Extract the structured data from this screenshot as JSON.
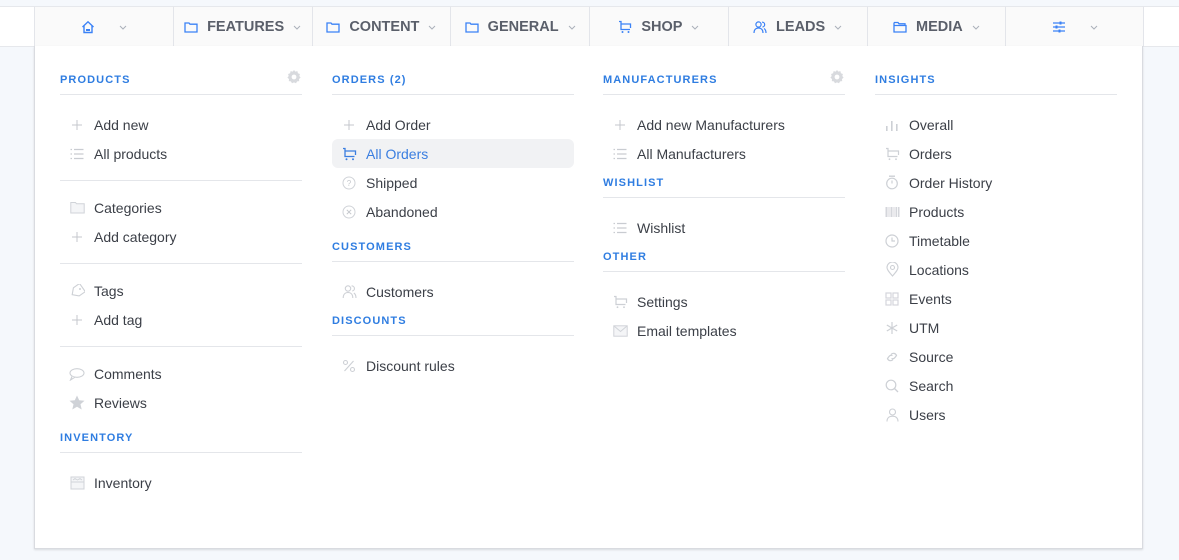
{
  "nav": {
    "items": [
      {
        "label": "",
        "icon": "home-icon"
      },
      {
        "label": "FEATURES",
        "icon": "folder-icon"
      },
      {
        "label": "CONTENT",
        "icon": "folder-icon"
      },
      {
        "label": "GENERAL",
        "icon": "folder-icon"
      },
      {
        "label": "SHOP",
        "icon": "cart-icon"
      },
      {
        "label": "LEADS",
        "icon": "users-icon"
      },
      {
        "label": "MEDIA",
        "icon": "folder-open-icon"
      },
      {
        "label": "",
        "icon": "sliders-icon"
      }
    ]
  },
  "colors": {
    "accent": "#2f7de1",
    "text": "#3b3f47",
    "icon_muted": "#c9ccd1",
    "active_bg": "#f1f2f4"
  },
  "products": {
    "title": "PRODUCTS",
    "group1": [
      {
        "label": "Add new",
        "icon": "plus-icon"
      },
      {
        "label": "All products",
        "icon": "list-icon"
      }
    ],
    "group2": [
      {
        "label": "Categories",
        "icon": "folder-icon"
      },
      {
        "label": "Add category",
        "icon": "plus-icon"
      }
    ],
    "group3": [
      {
        "label": "Tags",
        "icon": "tag-icon"
      },
      {
        "label": "Add tag",
        "icon": "plus-icon"
      }
    ],
    "group4": [
      {
        "label": "Comments",
        "icon": "comment-icon"
      },
      {
        "label": "Reviews",
        "icon": "star-icon"
      }
    ]
  },
  "inventory": {
    "title": "INVENTORY",
    "items": [
      {
        "label": "Inventory",
        "icon": "inventory-icon"
      }
    ]
  },
  "orders": {
    "title": "ORDERS (2)",
    "items": [
      {
        "label": "Add Order",
        "icon": "plus-icon"
      },
      {
        "label": "All Orders",
        "icon": "cart-icon",
        "active": true
      },
      {
        "label": "Shipped",
        "icon": "question-circle-icon"
      },
      {
        "label": "Abandoned",
        "icon": "x-circle-icon"
      }
    ]
  },
  "customers": {
    "title": "CUSTOMERS",
    "items": [
      {
        "label": "Customers",
        "icon": "users-icon"
      }
    ]
  },
  "discounts": {
    "title": "DISCOUNTS",
    "items": [
      {
        "label": "Discount rules",
        "icon": "percent-icon"
      }
    ]
  },
  "manufacturers": {
    "title": "MANUFACTURERS",
    "items": [
      {
        "label": "Add new Manufacturers",
        "icon": "plus-icon"
      },
      {
        "label": "All Manufacturers",
        "icon": "list-icon"
      }
    ]
  },
  "wishlist": {
    "title": "WISHLIST",
    "items": [
      {
        "label": "Wishlist",
        "icon": "list-icon"
      }
    ]
  },
  "other": {
    "title": "OTHER",
    "items": [
      {
        "label": "Settings",
        "icon": "cart-icon"
      },
      {
        "label": "Email templates",
        "icon": "mail-icon"
      }
    ]
  },
  "insights": {
    "title": "INSIGHTS",
    "items": [
      {
        "label": "Overall",
        "icon": "bar-chart-icon"
      },
      {
        "label": "Orders",
        "icon": "cart-icon"
      },
      {
        "label": "Order History",
        "icon": "stopwatch-icon"
      },
      {
        "label": "Products",
        "icon": "barcode-icon"
      },
      {
        "label": "Timetable",
        "icon": "clock-icon"
      },
      {
        "label": "Locations",
        "icon": "location-pin-icon"
      },
      {
        "label": "Events",
        "icon": "grid-icon"
      },
      {
        "label": "UTM",
        "icon": "asterisk-icon"
      },
      {
        "label": "Source",
        "icon": "link-icon"
      },
      {
        "label": "Search",
        "icon": "search-icon"
      },
      {
        "label": "Users",
        "icon": "user-icon"
      }
    ]
  }
}
